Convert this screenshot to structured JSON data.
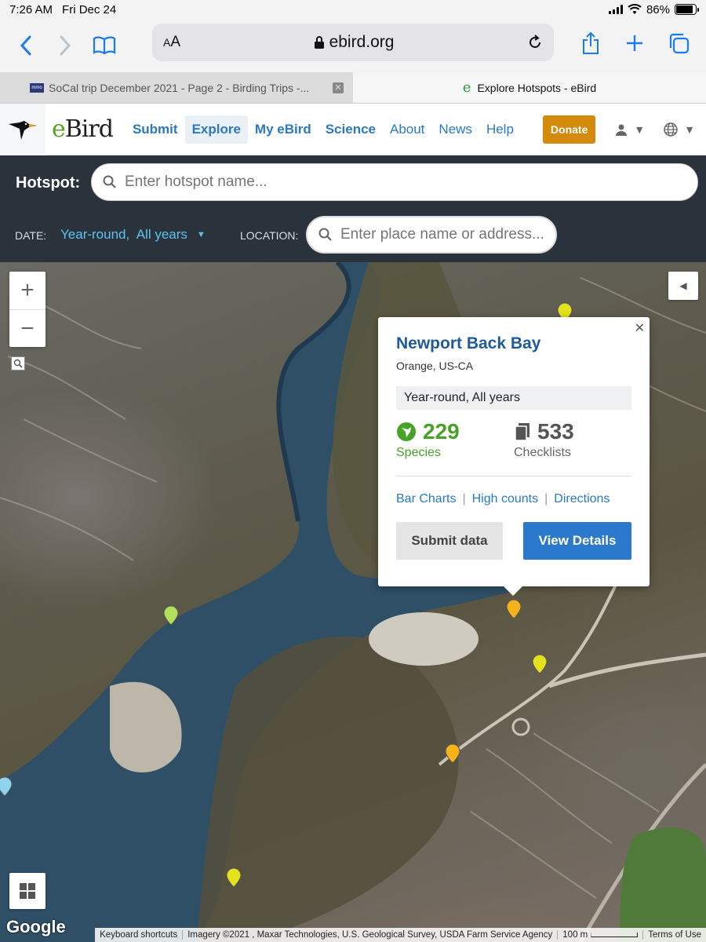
{
  "status": {
    "time": "7:26 AM",
    "date": "Fri Dec 24",
    "battery": "86%",
    "battery_level": 0.86
  },
  "browser": {
    "aa_label": "AA",
    "url": "ebird.org"
  },
  "tabs": [
    {
      "title": "SoCal trip December 2021 - Page 2 - Birding Trips -..."
    },
    {
      "title": "Explore Hotspots - eBird"
    }
  ],
  "nav": {
    "logo": "eBird",
    "items": [
      "Submit",
      "Explore",
      "My eBird",
      "Science",
      "About",
      "News",
      "Help"
    ],
    "donate": "Donate"
  },
  "search": {
    "hotspot_label": "Hotspot:",
    "hotspot_placeholder": "Enter hotspot name...",
    "date_label": "DATE:",
    "date_value": "Year-round,  All years",
    "location_label": "LOCATION:",
    "location_placeholder": "Enter place name or address..."
  },
  "popup": {
    "title": "Newport Back Bay",
    "region": "Orange, US-CA",
    "season": "Year-round, All years",
    "species_count": "229",
    "species_label": "Species",
    "checklists_count": "533",
    "checklists_label": "Checklists",
    "links": [
      "Bar Charts",
      "High counts",
      "Directions"
    ],
    "submit_button": "Submit data",
    "details_button": "View Details"
  },
  "map": {
    "google": "Google",
    "attribution": [
      "Keyboard shortcuts",
      "Imagery ©2021 , Maxar Technologies, U.S. Geological Survey, USDA Farm Service Agency",
      "100 m",
      "Terms of Use"
    ]
  },
  "colors": {
    "accent": "#2b79cd",
    "donate": "#d48a0b",
    "species": "#46a326",
    "panel": "#2a333c"
  }
}
